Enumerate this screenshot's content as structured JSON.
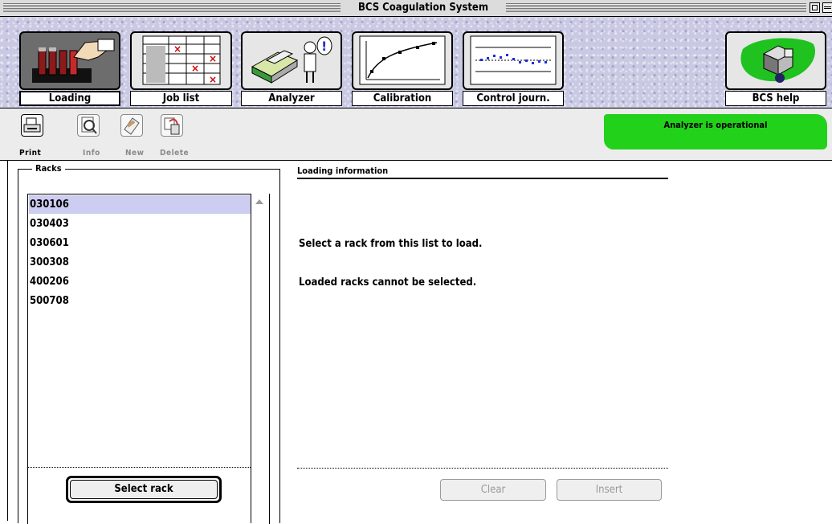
{
  "window": {
    "title": "BCS Coagulation System"
  },
  "nav": {
    "tabs": [
      {
        "label": "Loading",
        "icon": "loading-rack-icon",
        "active": true
      },
      {
        "label": "Job list",
        "icon": "job-list-grid-icon",
        "active": false
      },
      {
        "label": "Analyzer",
        "icon": "analyzer-machine-icon",
        "active": false
      },
      {
        "label": "Calibration",
        "icon": "calibration-curve-icon",
        "active": false
      },
      {
        "label": "Control journ.",
        "icon": "control-chart-icon",
        "active": false
      }
    ],
    "help": {
      "label": "BCS help",
      "icon": "help-cube-icon"
    }
  },
  "toolbar": {
    "print_label": "Print",
    "info_label": "Info",
    "new_label": "New",
    "delete_label": "Delete"
  },
  "status": {
    "text": "Analyzer is operational",
    "color": "#22d11a"
  },
  "racks": {
    "title": "Racks",
    "items": [
      {
        "label": "030106",
        "selected": true
      },
      {
        "label": "030403",
        "selected": false
      },
      {
        "label": "030601",
        "selected": false
      },
      {
        "label": "300308",
        "selected": false
      },
      {
        "label": "400206",
        "selected": false
      },
      {
        "label": "500708",
        "selected": false
      }
    ],
    "select_button": "Select rack"
  },
  "loading_info": {
    "heading": "Loading information",
    "message_1": "Select a rack from this list to load.",
    "message_2": "Loaded racks cannot be selected.",
    "clear_label": "Clear",
    "insert_label": "Insert"
  }
}
